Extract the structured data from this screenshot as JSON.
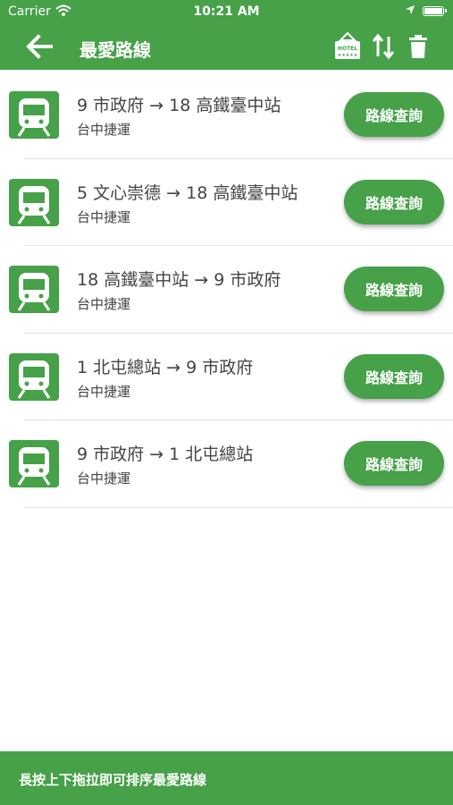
{
  "status_bar": {
    "carrier": "Carrier",
    "time": "10:21 AM"
  },
  "nav": {
    "title": "最愛路線",
    "icons": [
      "back-arrow-icon",
      "hotel-icon",
      "sort-icon",
      "trash-icon"
    ]
  },
  "routes": [
    {
      "title": "9 市政府 → 18 高鐵臺中站",
      "subtitle": "台中捷運",
      "button": "路線查詢"
    },
    {
      "title": "5 文心崇德 → 18 高鐵臺中站",
      "subtitle": "台中捷運",
      "button": "路線查詢"
    },
    {
      "title": "18 高鐵臺中站 → 9 市政府",
      "subtitle": "台中捷運",
      "button": "路線查詢"
    },
    {
      "title": "1 北屯總站 → 9 市政府",
      "subtitle": "台中捷運",
      "button": "路線查詢"
    },
    {
      "title": "9 市政府 → 1 北屯總站",
      "subtitle": "台中捷運",
      "button": "路線查詢"
    }
  ],
  "bottom_bar": {
    "hint": "長按上下拖拉即可排序最愛路線"
  },
  "colors": {
    "primary": "#46a148",
    "text": "#444444",
    "divider": "#e2e2e2"
  }
}
